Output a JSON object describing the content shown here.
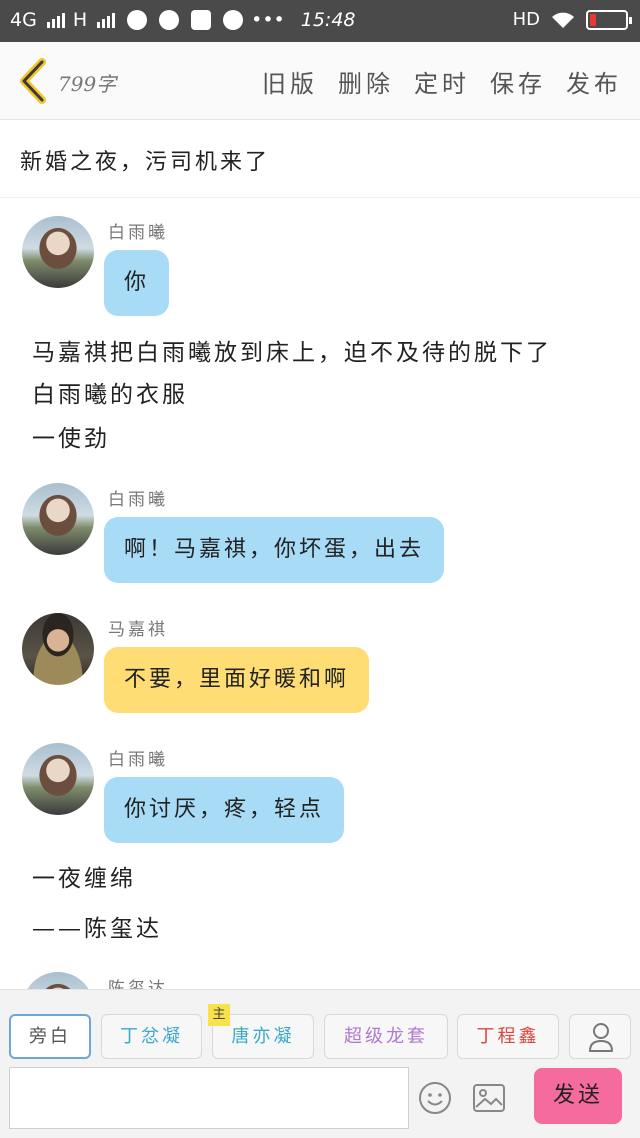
{
  "status_bar": {
    "network_1": "4G",
    "network_2": "H",
    "more": "•••",
    "time": "15:48",
    "hd": "HD"
  },
  "header": {
    "word_count": "799字",
    "actions": [
      "旧版",
      "删除",
      "定时",
      "保存",
      "发布"
    ]
  },
  "story": {
    "title": "新婚之夜，污司机来了"
  },
  "messages": [
    {
      "sender": "白雨曦",
      "text": "你",
      "bubble_color": "#a7dbf6",
      "avatar": "girl"
    },
    {
      "narration": [
        "马嘉祺把白雨曦放到床上，迫不及待的脱下了",
        "白雨曦的衣服"
      ]
    },
    {
      "narration": [
        "一使劲"
      ]
    },
    {
      "sender": "白雨曦",
      "text": "啊！马嘉祺，你坏蛋，出去",
      "bubble_color": "#a7dbf6",
      "avatar": "girl"
    },
    {
      "sender": "马嘉祺",
      "text": "不要，里面好暖和啊",
      "bubble_color": "#fddd74",
      "avatar": "boy"
    },
    {
      "sender": "白雨曦",
      "text": "你讨厌，疼，轻点",
      "bubble_color": "#a7dbf6",
      "avatar": "girl"
    },
    {
      "narration": [
        "一夜缠绵"
      ]
    },
    {
      "narration": [
        "——陈玺达"
      ]
    },
    {
      "sender": "陈玺达",
      "partial": true
    }
  ],
  "role_bar": {
    "roles": [
      {
        "label": "旁白",
        "color": "#555555",
        "active": true
      },
      {
        "label": "丁忿凝",
        "color": "#3aa9c9"
      },
      {
        "label": "唐亦凝",
        "color": "#3aa9c9",
        "badge": "主"
      },
      {
        "label": "超级龙套",
        "color": "#b07ad0"
      },
      {
        "label": "丁程鑫",
        "color": "#e0443e"
      }
    ]
  },
  "input_bar": {
    "placeholder": "",
    "send_label": "发送",
    "send_color": "#f56b9e"
  }
}
